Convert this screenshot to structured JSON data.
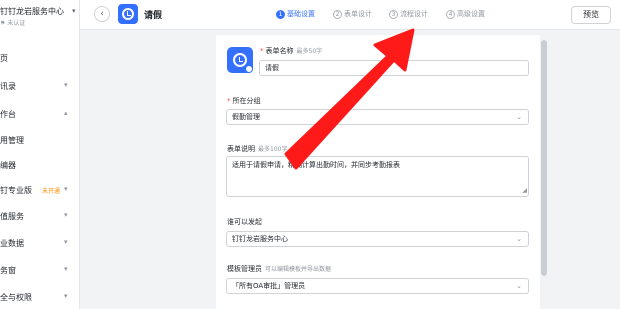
{
  "sidebar": {
    "org_name": "钉钉龙岩服务中心",
    "org_status": "未认证",
    "items": [
      {
        "label": "页",
        "has_chevron": false
      },
      {
        "label": "讯录",
        "has_chevron": true
      },
      {
        "label": "作台",
        "has_chevron": true
      },
      {
        "label": "用管理",
        "has_chevron": false
      },
      {
        "label": "编器",
        "has_chevron": false
      },
      {
        "label": "钉钉专业版",
        "badge": "未开通",
        "has_chevron": true
      },
      {
        "label": "值服务",
        "has_chevron": true
      },
      {
        "label": "业数据",
        "has_chevron": true
      },
      {
        "label": "务窗",
        "has_chevron": true
      },
      {
        "label": "全与权限",
        "has_chevron": true
      }
    ]
  },
  "header": {
    "back_icon": "‹",
    "title": "请假",
    "steps": [
      {
        "num": "1",
        "label": "基础设置",
        "active": true
      },
      {
        "num": "2",
        "label": "表单设计",
        "active": false
      },
      {
        "num": "3",
        "label": "流程设计",
        "active": false
      },
      {
        "num": "4",
        "label": "高级设置",
        "active": false
      }
    ],
    "preview_label": "预览"
  },
  "form": {
    "name": {
      "label": "表单名称",
      "hint": "最多50字",
      "value": "请假"
    },
    "group": {
      "label": "所在分组",
      "value": "假勤管理"
    },
    "description": {
      "label": "表单说明",
      "hint": "最多100字",
      "value": "适用于请假申请，精确计算出勤时间，并同步考勤报表"
    },
    "initiator": {
      "label": "谁可以发起",
      "value": "钉钉龙岩服务中心"
    },
    "admin": {
      "label": "模板管理员",
      "hint": "可以编辑模板并导出数据",
      "value": "「所有OA审批」管理员"
    }
  },
  "colors": {
    "accent": "#3370ff",
    "required": "#f54a45",
    "arrow": "#ff1a1a",
    "badge": "#ff8800"
  },
  "icons": {
    "app": "clock-icon",
    "dropdown": "chevron-down-icon",
    "back": "chevron-left-icon"
  }
}
